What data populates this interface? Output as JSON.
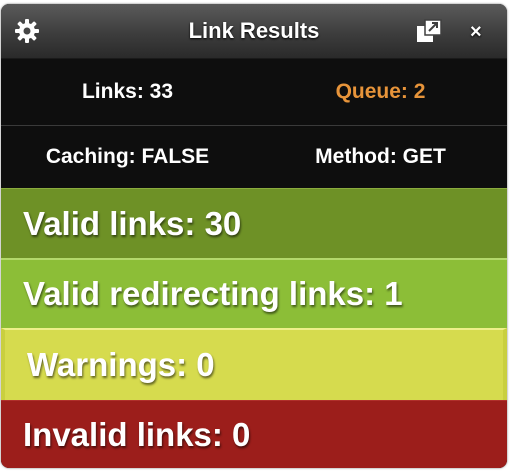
{
  "window": {
    "title": "Link Results",
    "close_label": "×",
    "icons": {
      "settings": "gear-icon",
      "popout": "popout-icon",
      "close": "close-icon"
    }
  },
  "stats": {
    "links": "Links: 33",
    "queue": "Queue: 2",
    "caching": "Caching: FALSE",
    "method": "Method: GET"
  },
  "results": {
    "valid": "Valid links: 30",
    "redirecting": "Valid redirecting links: 1",
    "warnings": "Warnings: 0",
    "invalid": "Invalid links: 0"
  },
  "colors": {
    "valid": "#6e9126",
    "redirecting": "#8cbe37",
    "warnings": "#d6db4e",
    "invalid": "#9c1e1b",
    "queue_text": "#e7943a"
  }
}
